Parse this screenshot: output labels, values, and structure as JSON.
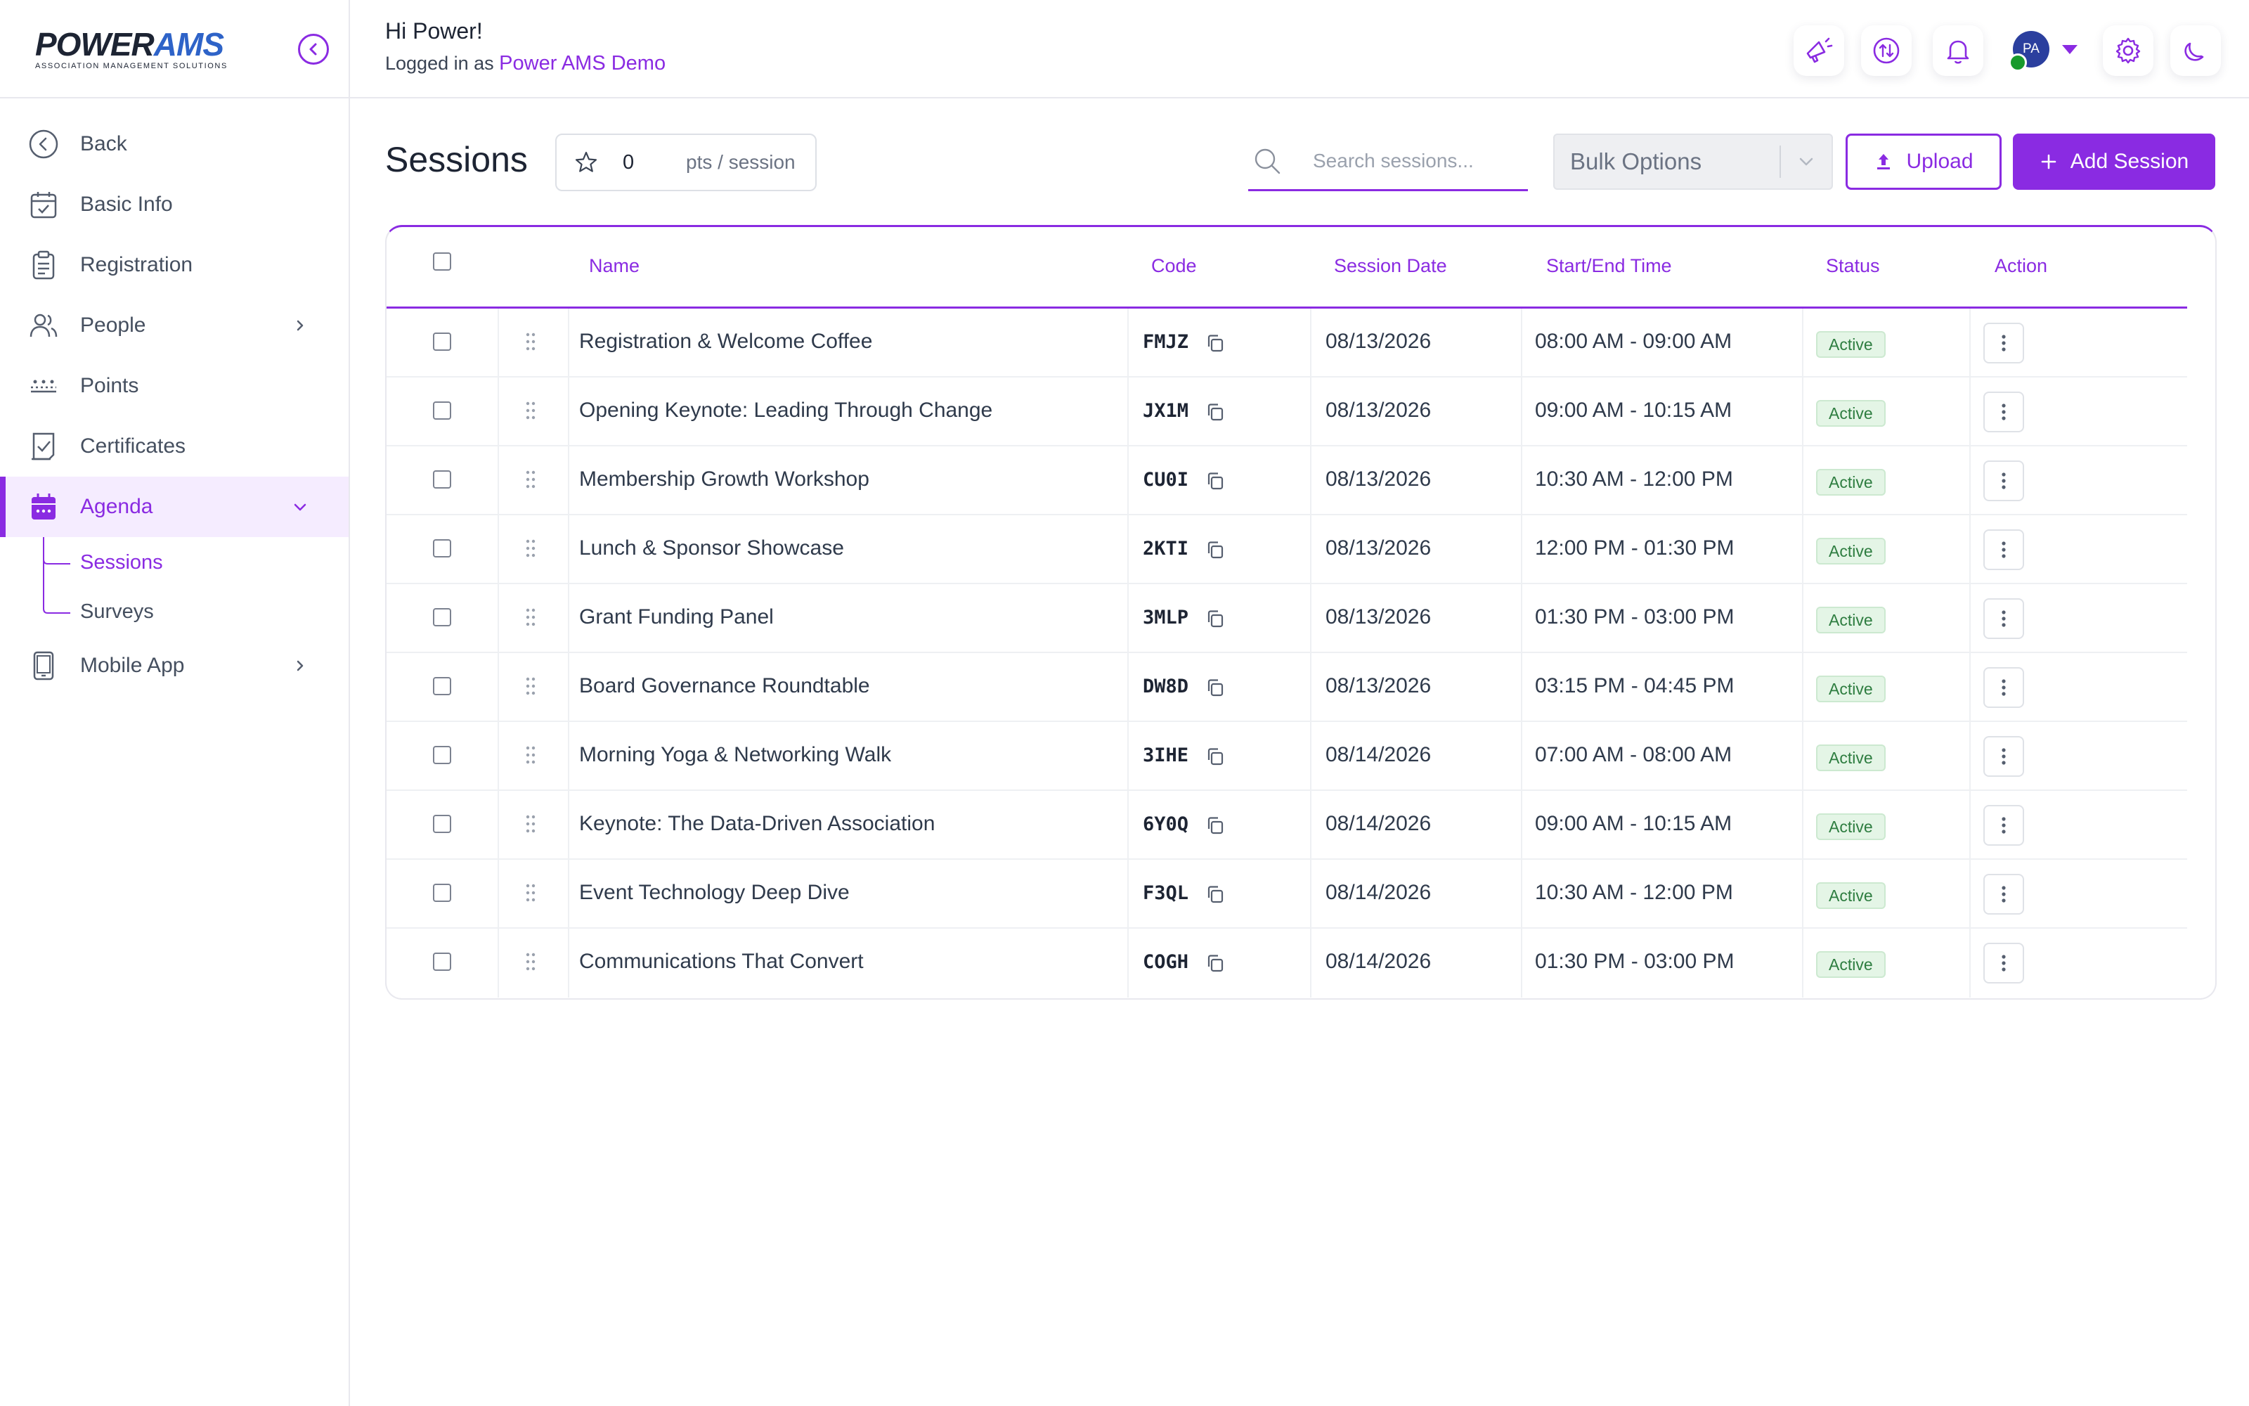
{
  "brand": {
    "name_part1": "POWER",
    "name_part2": "AMS",
    "tagline": "ASSOCIATION MANAGEMENT SOLUTIONS"
  },
  "header": {
    "greeting": "Hi Power!",
    "logged_in_prefix": "Logged in as",
    "logged_in_org": "Power AMS Demo",
    "avatar_initials": "PA",
    "icons": [
      "megaphone-icon",
      "exchange-icon",
      "bell-icon",
      "avatar",
      "gear-icon",
      "moon-icon"
    ]
  },
  "sidebar": {
    "items": [
      {
        "label": "Back",
        "icon": "back-circle-icon"
      },
      {
        "label": "Basic Info",
        "icon": "calendar-check-icon"
      },
      {
        "label": "Registration",
        "icon": "clipboard-icon"
      },
      {
        "label": "People",
        "icon": "people-icon",
        "has_children": true
      },
      {
        "label": "Points",
        "icon": "points-icon"
      },
      {
        "label": "Certificates",
        "icon": "certificate-icon"
      },
      {
        "label": "Agenda",
        "icon": "calendar-icon",
        "expanded": true,
        "active": true
      },
      {
        "label": "Mobile App",
        "icon": "mobile-icon",
        "has_children": true
      }
    ],
    "agenda_subitems": [
      {
        "label": "Sessions",
        "active": true
      },
      {
        "label": "Surveys"
      }
    ]
  },
  "page": {
    "title": "Sessions",
    "points_value": "0",
    "points_unit": "pts / session",
    "search_placeholder": "Search sessions...",
    "bulk_options_label": "Bulk Options",
    "upload_label": "Upload",
    "add_session_label": "Add Session"
  },
  "table": {
    "columns": [
      "Name",
      "Code",
      "Session Date",
      "Start/End Time",
      "Status",
      "Action"
    ],
    "rows": [
      {
        "name": "Registration & Welcome Coffee",
        "code": "FMJZ",
        "date": "08/13/2026",
        "time": "08:00 AM - 09:00 AM",
        "status": "Active"
      },
      {
        "name": "Opening Keynote: Leading Through Change",
        "code": "JX1M",
        "date": "08/13/2026",
        "time": "09:00 AM - 10:15 AM",
        "status": "Active"
      },
      {
        "name": "Membership Growth Workshop",
        "code": "CU0I",
        "date": "08/13/2026",
        "time": "10:30 AM - 12:00 PM",
        "status": "Active"
      },
      {
        "name": "Lunch & Sponsor Showcase",
        "code": "2KTI",
        "date": "08/13/2026",
        "time": "12:00 PM - 01:30 PM",
        "status": "Active"
      },
      {
        "name": "Grant Funding Panel",
        "code": "3MLP",
        "date": "08/13/2026",
        "time": "01:30 PM - 03:00 PM",
        "status": "Active"
      },
      {
        "name": "Board Governance Roundtable",
        "code": "DW8D",
        "date": "08/13/2026",
        "time": "03:15 PM - 04:45 PM",
        "status": "Active"
      },
      {
        "name": "Morning Yoga & Networking Walk",
        "code": "3IHE",
        "date": "08/14/2026",
        "time": "07:00 AM - 08:00 AM",
        "status": "Active"
      },
      {
        "name": "Keynote: The Data-Driven Association",
        "code": "6Y0Q",
        "date": "08/14/2026",
        "time": "09:00 AM - 10:15 AM",
        "status": "Active"
      },
      {
        "name": "Event Technology Deep Dive",
        "code": "F3QL",
        "date": "08/14/2026",
        "time": "10:30 AM - 12:00 PM",
        "status": "Active"
      },
      {
        "name": "Communications That Convert",
        "code": "COGH",
        "date": "08/14/2026",
        "time": "01:30 PM - 03:00 PM",
        "status": "Active"
      }
    ]
  },
  "colors": {
    "accent": "#8a2be2",
    "brand_blue": "#2e63c8",
    "status_active_bg": "#e4f5e6",
    "status_active_text": "#2e7d40"
  }
}
